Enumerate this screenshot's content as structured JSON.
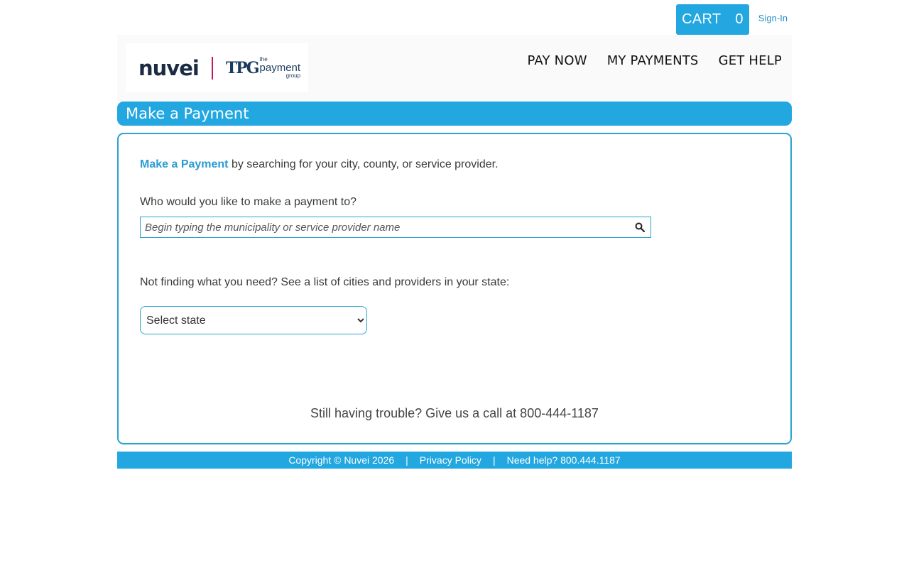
{
  "header": {
    "cart_label": "CART",
    "cart_count": "0",
    "signin_label": "Sign-In",
    "logo": {
      "brand": "nuvei",
      "partner_mark": "TPG",
      "partner_the": "the",
      "partner_payment": "payment",
      "partner_group": "group"
    },
    "nav": [
      {
        "label": "PAY NOW"
      },
      {
        "label": "MY PAYMENTS"
      },
      {
        "label": "GET HELP"
      }
    ]
  },
  "page_title": "Make a Payment",
  "main": {
    "intro_highlight": "Make a Payment",
    "intro_rest": " by searching for your city, county, or service provider.",
    "question": "Who would you like to make a payment to?",
    "search_placeholder": "Begin typing the municipality or service provider name",
    "not_finding": "Not finding what you need? See a list of cities and providers in your state:",
    "state_select_value": "Select state",
    "trouble": "Still having trouble? Give us a call at 800-444-1187"
  },
  "footer": {
    "copyright": "Copyright © Nuvei 2026",
    "sep1": "|",
    "privacy": "Privacy Policy",
    "sep2": "|",
    "help": "Need help? 800.444.1187"
  },
  "colors": {
    "accent": "#22a7e0",
    "border": "#2aa3cf",
    "link": "#2a9bd2",
    "logo_separator": "#c4185c"
  }
}
